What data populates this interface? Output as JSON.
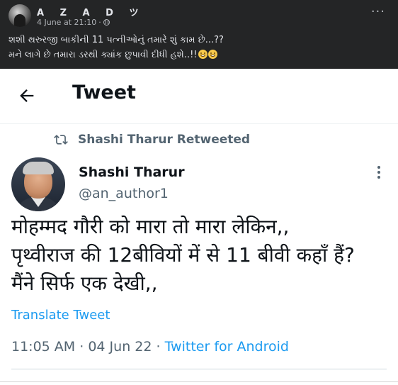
{
  "facebook_post": {
    "author": "A Z A D ツ",
    "date": "4 June at 21:10",
    "date_separator": "·",
    "more_label": "···",
    "text_lines": [
      "શશી થરુરજી બાકીની 11 પત્નીઓનું  તમારે શું કામ છે...??",
      "મને લાગે છે તમારા ડરથી ક્યાંક છુપાવી દીધી હશે..!!"
    ],
    "emoji_count": 2
  },
  "tweet_view": {
    "header_title": "Tweet",
    "retweet_label": "Shashi Tharur Retweeted",
    "author_name": "Shashi Tharur",
    "author_handle": "@an_author1",
    "body_lines": [
      "मोहम्मद गौरी को मारा तो मारा लेकिन,,",
      "पृथ्वीराज की 12बीवियों में से 11 बीवी कहाँ हैं?",
      "मैंने सिर्फ एक देखी,,"
    ],
    "translate_label": "Translate Tweet",
    "time": "11:05 AM",
    "date": "04 Jun 22",
    "source": "Twitter for Android",
    "meta_separator": "·"
  },
  "colors": {
    "facebook_bg": "#242526",
    "twitter_text": "#0f1419",
    "twitter_secondary": "#536471",
    "twitter_blue": "#1d9bf0"
  }
}
